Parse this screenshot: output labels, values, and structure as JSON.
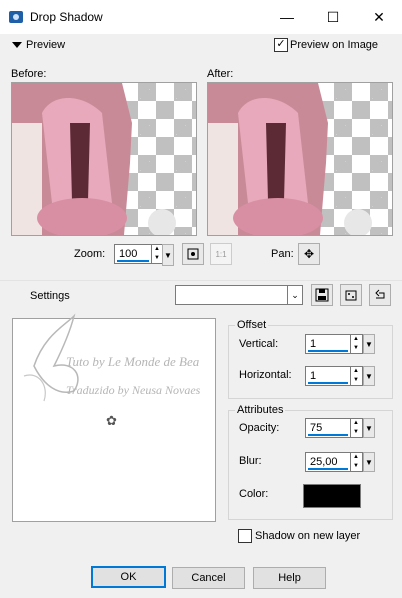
{
  "window": {
    "title": "Drop Shadow",
    "minimize": "—",
    "maximize": "☐",
    "close": "✕"
  },
  "preview": {
    "toggle_label": "Preview",
    "preview_on_image_label": "Preview on Image",
    "preview_on_image_checked": true
  },
  "images": {
    "before_label": "Before:",
    "after_label": "After:"
  },
  "zoom": {
    "label": "Zoom:",
    "value": "100",
    "pan_label": "Pan:"
  },
  "settings": {
    "label": "Settings",
    "preset_value": ""
  },
  "watermark": {
    "line1": "Tuto by Le Monde de Bea",
    "line2": "Traduzido by Neusa Novaes"
  },
  "offset": {
    "group_label": "Offset",
    "vertical_label": "Vertical:",
    "vertical_value": "1",
    "horizontal_label": "Horizontal:",
    "horizontal_value": "1"
  },
  "attributes": {
    "group_label": "Attributes",
    "opacity_label": "Opacity:",
    "opacity_value": "75",
    "blur_label": "Blur:",
    "blur_value": "25,00",
    "color_label": "Color:",
    "color_value": "#000000"
  },
  "shadow_new_layer": {
    "label": "Shadow on new layer",
    "checked": false
  },
  "buttons": {
    "ok": "OK",
    "cancel": "Cancel",
    "help": "Help"
  }
}
